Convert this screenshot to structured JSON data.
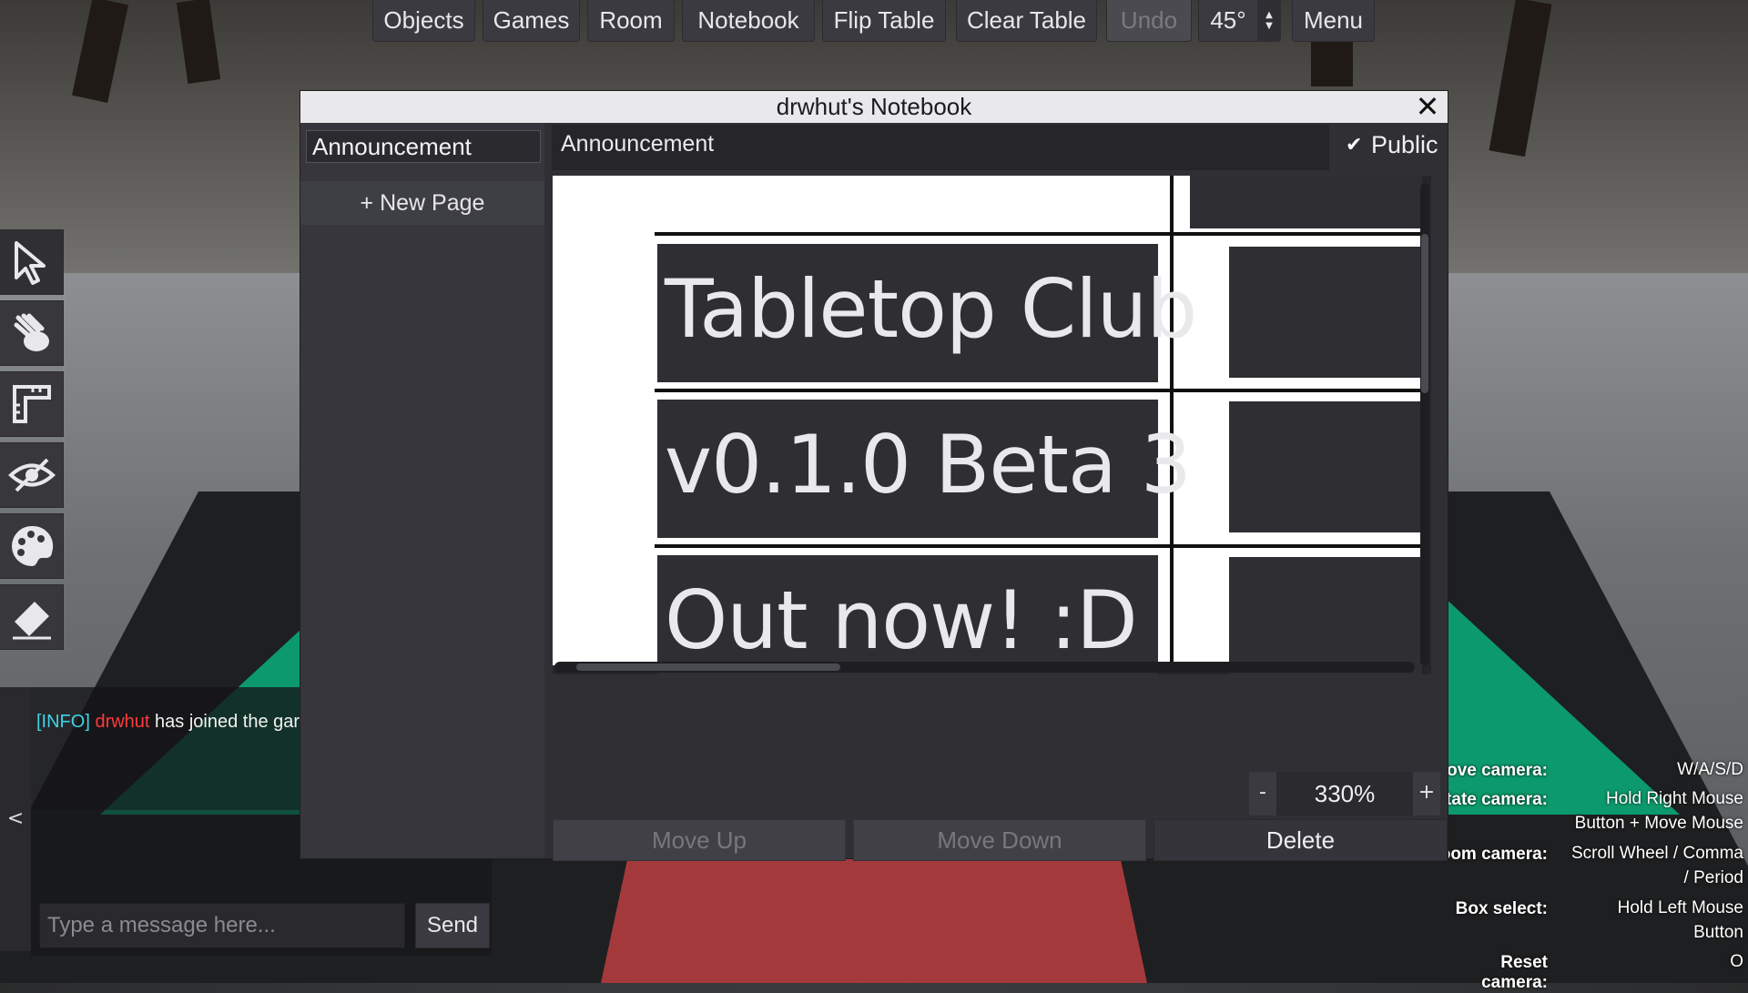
{
  "top_menu": {
    "objects": "Objects",
    "games": "Games",
    "room": "Room",
    "notebook": "Notebook",
    "flip_table": "Flip Table",
    "clear_table": "Clear Table",
    "undo": "Undo",
    "camera_angle": "45°",
    "menu": "Menu"
  },
  "tools": [
    {
      "icon": "cursor-icon"
    },
    {
      "icon": "grab-hand-icon"
    },
    {
      "icon": "ruler-icon"
    },
    {
      "icon": "hidden-eye-icon"
    },
    {
      "icon": "paint-palette-icon"
    },
    {
      "icon": "eraser-icon"
    }
  ],
  "chat": {
    "collapse_label": "<",
    "line": {
      "tag": "[INFO]",
      "user": "drwhut",
      "message": " has joined the gar"
    },
    "input_placeholder": "Type a message here...",
    "send_label": "Send"
  },
  "help": [
    {
      "key": "ove camera:",
      "value": "W/A/S/D"
    },
    {
      "key": "otate camera:",
      "value": "Hold Right Mouse Button + Move Mouse"
    },
    {
      "key": "oom camera:",
      "value": "Scroll Wheel / Comma / Period"
    },
    {
      "key": "Box select:",
      "value": "Hold Left Mouse Button"
    },
    {
      "key": "Reset camera:",
      "value": "O"
    }
  ],
  "notebook": {
    "title": "drwhut's Notebook",
    "close": "✕",
    "pages": [
      {
        "label": "Announcement"
      }
    ],
    "new_page_label": "+ New Page",
    "page_title": "Announcement",
    "public_label": "Public",
    "public_checked": true,
    "image_rows": [
      "Tabletop Club",
      "v0.1.0 Beta 3",
      "Out now! :D"
    ],
    "zoom_minus": "-",
    "zoom_value": "330%",
    "zoom_plus": "+",
    "move_up": "Move Up",
    "move_down": "Move Down",
    "delete": "Delete"
  },
  "colors": {
    "felt": "#0c9a6c",
    "mat": "#a4393b",
    "chat_info": "#3fd3e8",
    "chat_user": "#ff3b3b"
  }
}
